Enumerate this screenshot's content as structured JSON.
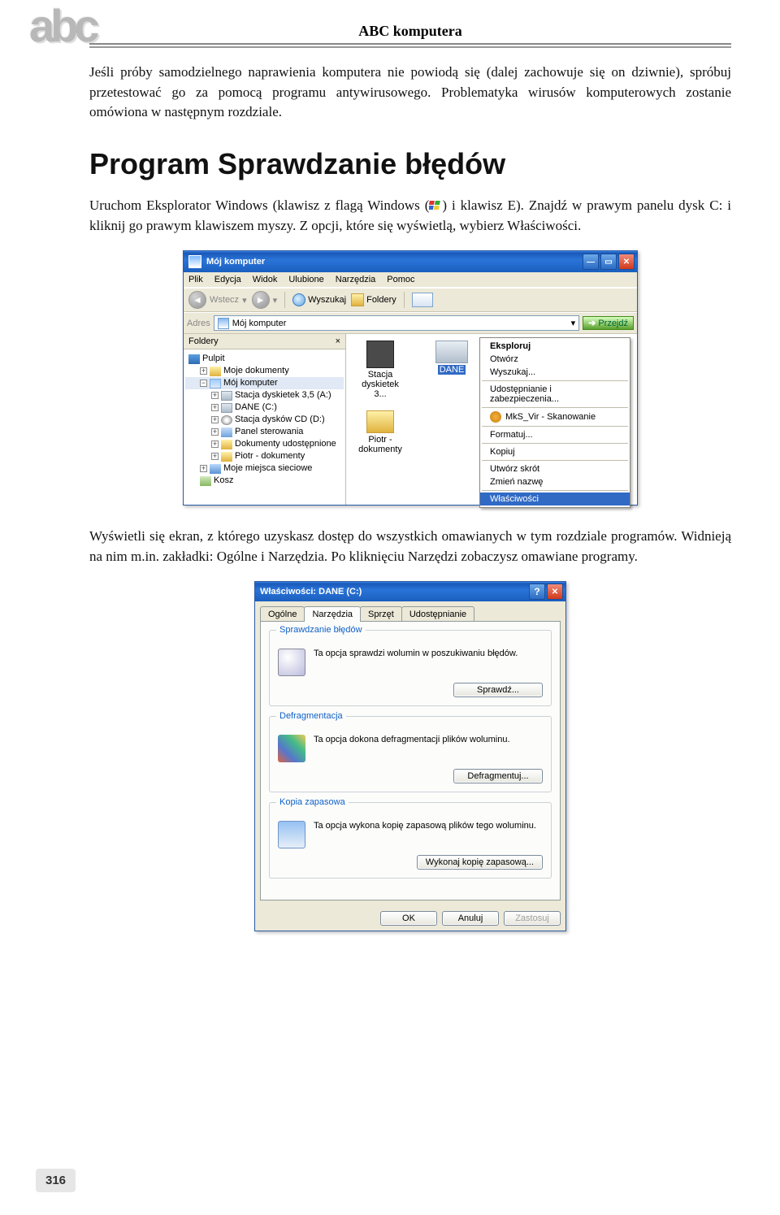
{
  "abc_logo": "abc",
  "book_title": "ABC komputera",
  "para1": "Jeśli próby samodzielnego naprawienia komputera nie powiodą się (dalej zachowuje się on dziwnie), spróbuj przetestować go za pomocą programu antywirusowego. Problematyka wirusów komputerowych zostanie omówiona w następnym rozdziale.",
  "heading": "Program Sprawdzanie błędów",
  "para2_pre": "Uruchom Eksplorator Windows (klawisz z flagą Windows (",
  "para2_post": ") i klawisz E). Znajdź w prawym panelu dysk C: i kliknij go prawym klawiszem myszy. Z opcji, które się wyświetlą, wybierz Właściwości.",
  "para3": "Wyświetli się ekran, z którego uzyskasz dostęp do wszystkich omawianych w tym rozdziale programów. Widnieją na nim m.in. zakładki: Ogólne i Narzędzia. Po kliknięciu Narzędzi zobaczysz omawiane programy.",
  "explorer": {
    "title": "Mój komputer",
    "menu": [
      "Plik",
      "Edycja",
      "Widok",
      "Ulubione",
      "Narzędzia",
      "Pomoc"
    ],
    "toolbar": {
      "back": "Wstecz",
      "search": "Wyszukaj",
      "folders": "Foldery"
    },
    "address_label": "Adres",
    "address_value": "Mój komputer",
    "go": "Przejdź",
    "sidebar_header": "Foldery",
    "tree": {
      "desktop": "Pulpit",
      "mydocs": "Moje dokumenty",
      "mycomp": "Mój komputer",
      "floppy": "Stacja dyskietek 3,5 (A:)",
      "dane": "DANE (C:)",
      "cd": "Stacja dysków CD (D:)",
      "cpanel": "Panel sterowania",
      "shared": "Dokumenty udostępnione",
      "piotr": "Piotr - dokumenty",
      "netplaces": "Moje miejsca sieciowe",
      "bin": "Kosz"
    },
    "files": {
      "floppy": "Stacja dyskietek 3...",
      "piotr": "Piotr - dokumenty",
      "dane": "DANE"
    },
    "ctx": {
      "explore": "Eksploruj",
      "open": "Otwórz",
      "search": "Wyszukaj...",
      "share": "Udostępnianie i zabezpieczenia...",
      "mks": "MkS_Vir - Skanowanie",
      "format": "Formatuj...",
      "copy": "Kopiuj",
      "shortcut": "Utwórz skrót",
      "rename": "Zmień nazwę",
      "props": "Właściwości"
    }
  },
  "dialog": {
    "title": "Właściwości: DANE (C:)",
    "tabs": [
      "Ogólne",
      "Narzędzia",
      "Sprzęt",
      "Udostępnianie"
    ],
    "active_tab": 1,
    "group1": {
      "legend": "Sprawdzanie błędów",
      "text": "Ta opcja sprawdzi wolumin w poszukiwaniu błędów.",
      "button": "Sprawdź..."
    },
    "group2": {
      "legend": "Defragmentacja",
      "text": "Ta opcja dokona defragmentacji plików woluminu.",
      "button": "Defragmentuj..."
    },
    "group3": {
      "legend": "Kopia zapasowa",
      "text": "Ta opcja wykona kopię zapasową plików tego woluminu.",
      "button": "Wykonaj kopię zapasową..."
    },
    "ok": "OK",
    "cancel": "Anuluj",
    "apply": "Zastosuj"
  },
  "page_number": "316"
}
